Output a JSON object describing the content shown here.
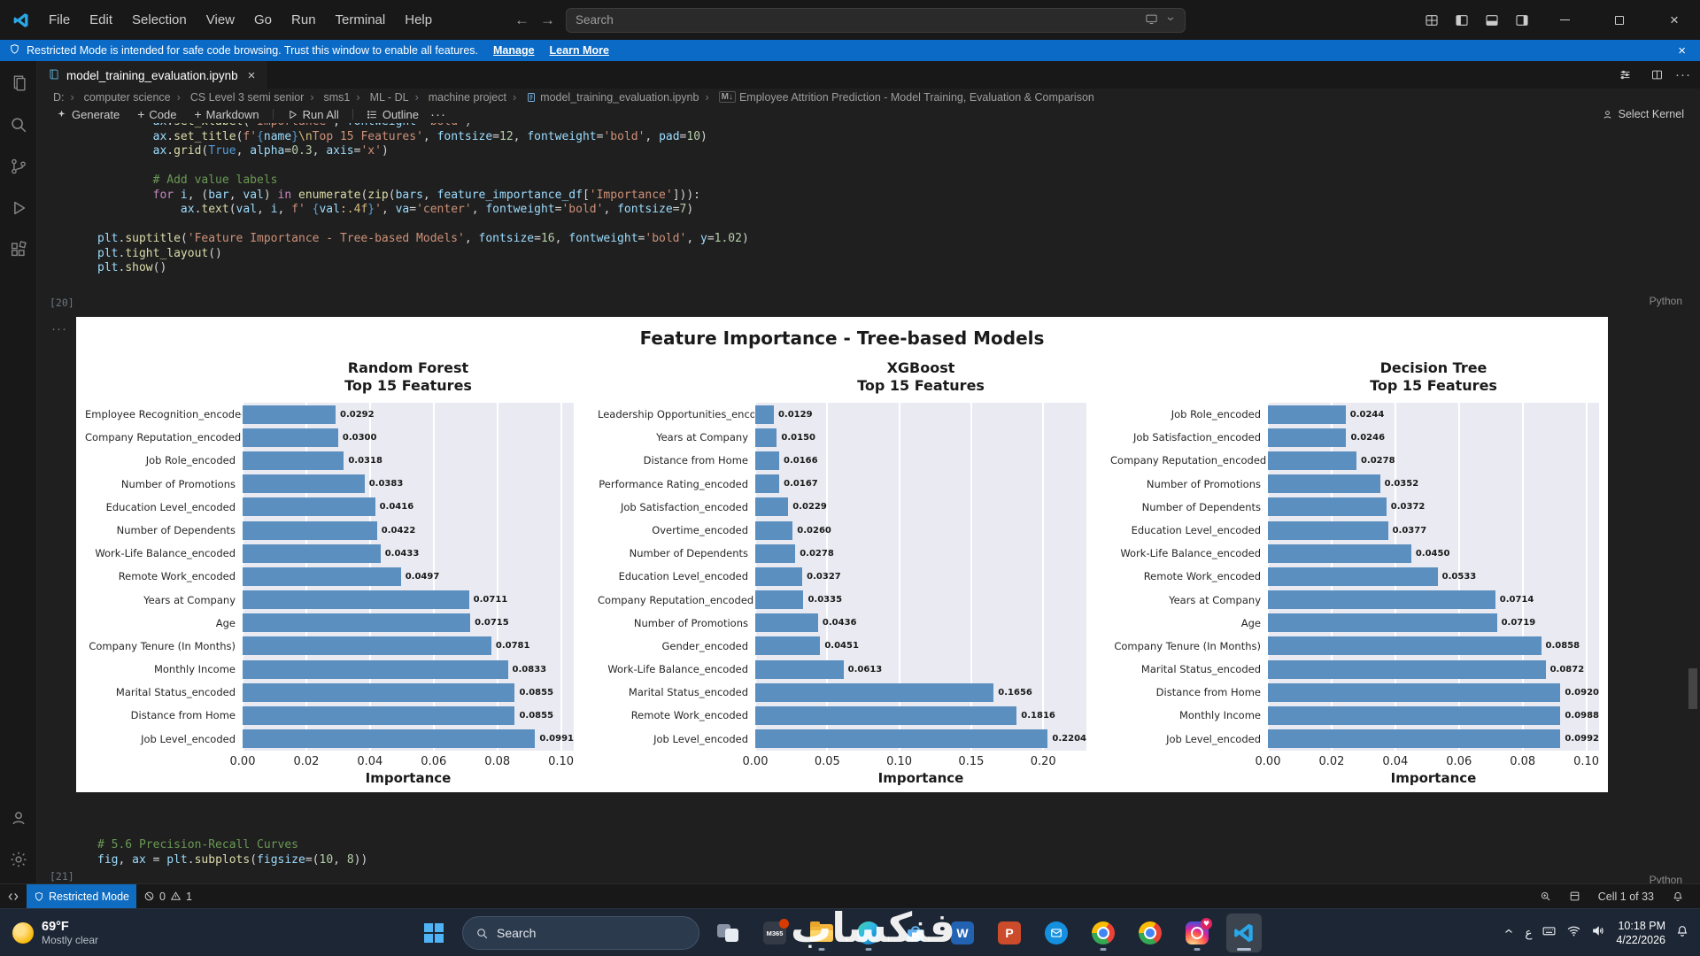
{
  "window": {
    "menus": [
      "File",
      "Edit",
      "Selection",
      "View",
      "Go",
      "Run",
      "Terminal",
      "Help"
    ],
    "search_label": "Search"
  },
  "banner": {
    "text": "Restricted Mode is intended for safe code browsing. Trust this window to enable all features.",
    "manage": "Manage",
    "learn_more": "Learn More"
  },
  "tab": {
    "title": "model_training_evaluation.ipynb"
  },
  "breadcrumbs": {
    "items": [
      "D:",
      "computer science",
      "CS Level 3 semi senior",
      "sms1",
      "ML - DL",
      "machine project",
      "model_training_evaluation.ipynb",
      "Employee Attrition Prediction - Model Training, Evaluation & Comparison"
    ]
  },
  "nbtoolbar": {
    "generate": "Generate",
    "add_code": "Code",
    "add_markdown": "Markdown",
    "run_all": "Run All",
    "outline": "Outline",
    "select_kernel": "Select Kernel"
  },
  "cells": [
    {
      "exec": "[20]",
      "lang": "Python",
      "lines": [
        [
          [
            "v",
            "        ax"
          ],
          [
            "p",
            "."
          ],
          [
            "f",
            "set_xlabel"
          ],
          [
            "p",
            "("
          ],
          [
            "s",
            "'Importance'"
          ],
          [
            "p",
            ", "
          ],
          [
            "v",
            "fontweight"
          ],
          [
            "p",
            "="
          ],
          [
            "s",
            "'bold'"
          ],
          [
            "p",
            ")"
          ]
        ],
        [
          [
            "v",
            "        ax"
          ],
          [
            "p",
            "."
          ],
          [
            "f",
            "set_title"
          ],
          [
            "p",
            "("
          ],
          [
            "s",
            "f'"
          ],
          [
            "b",
            "{"
          ],
          [
            "v",
            "name"
          ],
          [
            "b",
            "}"
          ],
          [
            "e",
            "\\n"
          ],
          [
            "s",
            "Top 15 Features'"
          ],
          [
            "p",
            ", "
          ],
          [
            "v",
            "fontsize"
          ],
          [
            "p",
            "="
          ],
          [
            "n",
            "12"
          ],
          [
            "p",
            ", "
          ],
          [
            "v",
            "fontweight"
          ],
          [
            "p",
            "="
          ],
          [
            "s",
            "'bold'"
          ],
          [
            "p",
            ", "
          ],
          [
            "v",
            "pad"
          ],
          [
            "p",
            "="
          ],
          [
            "n",
            "10"
          ],
          [
            "p",
            ")"
          ]
        ],
        [
          [
            "v",
            "        ax"
          ],
          [
            "p",
            "."
          ],
          [
            "f",
            "grid"
          ],
          [
            "p",
            "("
          ],
          [
            "b",
            "True"
          ],
          [
            "p",
            ", "
          ],
          [
            "v",
            "alpha"
          ],
          [
            "p",
            "="
          ],
          [
            "n",
            "0.3"
          ],
          [
            "p",
            ", "
          ],
          [
            "v",
            "axis"
          ],
          [
            "p",
            "="
          ],
          [
            "s",
            "'x'"
          ],
          [
            "p",
            ")"
          ]
        ],
        [],
        [
          [
            "c",
            "        # Add value labels"
          ]
        ],
        [
          [
            "k",
            "        for"
          ],
          [
            "p",
            " "
          ],
          [
            "v",
            "i"
          ],
          [
            "p",
            ", ("
          ],
          [
            "v",
            "bar"
          ],
          [
            "p",
            ", "
          ],
          [
            "v",
            "val"
          ],
          [
            "p",
            ") "
          ],
          [
            "k",
            "in"
          ],
          [
            "p",
            " "
          ],
          [
            "f",
            "enumerate"
          ],
          [
            "p",
            "("
          ],
          [
            "f",
            "zip"
          ],
          [
            "p",
            "("
          ],
          [
            "v",
            "bars"
          ],
          [
            "p",
            ", "
          ],
          [
            "v",
            "feature_importance_df"
          ],
          [
            "p",
            "["
          ],
          [
            "s",
            "'Importance'"
          ],
          [
            "p",
            "])):"
          ]
        ],
        [
          [
            "v",
            "            ax"
          ],
          [
            "p",
            "."
          ],
          [
            "f",
            "text"
          ],
          [
            "p",
            "("
          ],
          [
            "v",
            "val"
          ],
          [
            "p",
            ", "
          ],
          [
            "v",
            "i"
          ],
          [
            "p",
            ", "
          ],
          [
            "s",
            "f' "
          ],
          [
            "b",
            "{"
          ],
          [
            "v",
            "val"
          ],
          [
            "e",
            ":.4f"
          ],
          [
            "b",
            "}"
          ],
          [
            "s",
            "'"
          ],
          [
            "p",
            ", "
          ],
          [
            "v",
            "va"
          ],
          [
            "p",
            "="
          ],
          [
            "s",
            "'center'"
          ],
          [
            "p",
            ", "
          ],
          [
            "v",
            "fontweight"
          ],
          [
            "p",
            "="
          ],
          [
            "s",
            "'bold'"
          ],
          [
            "p",
            ", "
          ],
          [
            "v",
            "fontsize"
          ],
          [
            "p",
            "="
          ],
          [
            "n",
            "7"
          ],
          [
            "p",
            ")"
          ]
        ],
        [],
        [
          [
            "v",
            "plt"
          ],
          [
            "p",
            "."
          ],
          [
            "f",
            "suptitle"
          ],
          [
            "p",
            "("
          ],
          [
            "s",
            "'Feature Importance - Tree-based Models'"
          ],
          [
            "p",
            ", "
          ],
          [
            "v",
            "fontsize"
          ],
          [
            "p",
            "="
          ],
          [
            "n",
            "16"
          ],
          [
            "p",
            ", "
          ],
          [
            "v",
            "fontweight"
          ],
          [
            "p",
            "="
          ],
          [
            "s",
            "'bold'"
          ],
          [
            "p",
            ", "
          ],
          [
            "v",
            "y"
          ],
          [
            "p",
            "="
          ],
          [
            "n",
            "1.02"
          ],
          [
            "p",
            ")"
          ]
        ],
        [
          [
            "v",
            "plt"
          ],
          [
            "p",
            "."
          ],
          [
            "f",
            "tight_layout"
          ],
          [
            "p",
            "()"
          ]
        ],
        [
          [
            "v",
            "plt"
          ],
          [
            "p",
            "."
          ],
          [
            "f",
            "show"
          ],
          [
            "p",
            "()"
          ]
        ]
      ]
    },
    {
      "exec": "[21]",
      "lang": "Python",
      "lines": [
        [
          [
            "c",
            "# 5.6 Precision-Recall Curves"
          ]
        ],
        [
          [
            "v",
            "fig"
          ],
          [
            "p",
            ", "
          ],
          [
            "v",
            "ax"
          ],
          [
            "p",
            " = "
          ],
          [
            "v",
            "plt"
          ],
          [
            "p",
            "."
          ],
          [
            "f",
            "subplots"
          ],
          [
            "p",
            "("
          ],
          [
            "v",
            "figsize"
          ],
          [
            "p",
            "=("
          ],
          [
            "n",
            "10"
          ],
          [
            "p",
            ", "
          ],
          [
            "n",
            "8"
          ],
          [
            "p",
            "))"
          ]
        ]
      ]
    }
  ],
  "figure": {
    "suptitle": "Feature Importance - Tree-based Models"
  },
  "chart_data": [
    {
      "type": "bar",
      "orientation": "horizontal",
      "name": "Random Forest",
      "subtitle": "Top 15 Features",
      "xlabel": "Importance",
      "xmax": 0.104,
      "tick_values": [
        0,
        0.02,
        0.04,
        0.06,
        0.08,
        0.1
      ],
      "categories": [
        "Employee Recognition_encoded",
        "Company Reputation_encoded",
        "Job Role_encoded",
        "Number of Promotions",
        "Education Level_encoded",
        "Number of Dependents",
        "Work-Life Balance_encoded",
        "Remote Work_encoded",
        "Years at Company",
        "Age",
        "Company Tenure (In Months)",
        "Monthly Income",
        "Marital Status_encoded",
        "Distance from Home",
        "Job Level_encoded"
      ],
      "values": [
        0.0292,
        0.03,
        0.0318,
        0.0383,
        0.0416,
        0.0422,
        0.0433,
        0.0497,
        0.0711,
        0.0715,
        0.0781,
        0.0833,
        0.0855,
        0.0855,
        0.0991
      ]
    },
    {
      "type": "bar",
      "orientation": "horizontal",
      "name": "XGBoost",
      "subtitle": "Top 15 Features",
      "xlabel": "Importance",
      "xmax": 0.23,
      "tick_values": [
        0,
        0.05,
        0.1,
        0.15,
        0.2
      ],
      "categories": [
        "Leadership Opportunities_encoded",
        "Years at Company",
        "Distance from Home",
        "Performance Rating_encoded",
        "Job Satisfaction_encoded",
        "Overtime_encoded",
        "Number of Dependents",
        "Education Level_encoded",
        "Company Reputation_encoded",
        "Number of Promotions",
        "Gender_encoded",
        "Work-Life Balance_encoded",
        "Marital Status_encoded",
        "Remote Work_encoded",
        "Job Level_encoded"
      ],
      "values": [
        0.0129,
        0.015,
        0.0166,
        0.0167,
        0.0229,
        0.026,
        0.0278,
        0.0327,
        0.0335,
        0.0436,
        0.0451,
        0.0613,
        0.1656,
        0.1816,
        0.2204
      ]
    },
    {
      "type": "bar",
      "orientation": "horizontal",
      "name": "Decision Tree",
      "subtitle": "Top 15 Features",
      "xlabel": "Importance",
      "xmax": 0.104,
      "tick_values": [
        0,
        0.02,
        0.04,
        0.06,
        0.08,
        0.1
      ],
      "categories": [
        "Job Role_encoded",
        "Job Satisfaction_encoded",
        "Company Reputation_encoded",
        "Number of Promotions",
        "Number of Dependents",
        "Education Level_encoded",
        "Work-Life Balance_encoded",
        "Remote Work_encoded",
        "Years at Company",
        "Age",
        "Company Tenure (In Months)",
        "Marital Status_encoded",
        "Distance from Home",
        "Monthly Income",
        "Job Level_encoded"
      ],
      "values": [
        0.0244,
        0.0246,
        0.0278,
        0.0352,
        0.0372,
        0.0377,
        0.045,
        0.0533,
        0.0714,
        0.0719,
        0.0858,
        0.0872,
        0.092,
        0.0988,
        0.0992
      ]
    }
  ],
  "statusbar": {
    "restricted_mode": "Restricted Mode",
    "errors": "0",
    "warnings": "1",
    "cell_indicator": "Cell 1 of 33"
  },
  "taskbar": {
    "weather_temp": "69°F",
    "weather_desc": "Mostly clear",
    "search_label": "Search",
    "m365_label": "M365",
    "language": "ع",
    "time": "10:18 PM",
    "date": "4/22/2026"
  },
  "watermark": "فنكساب"
}
